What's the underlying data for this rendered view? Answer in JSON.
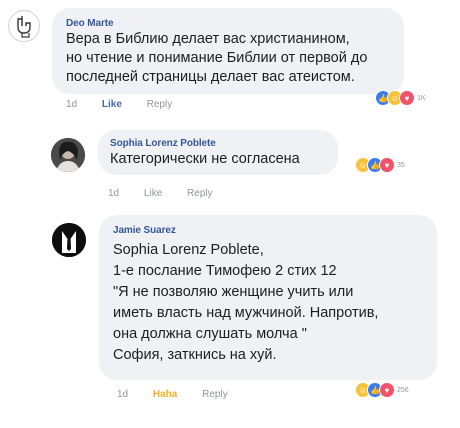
{
  "comments": [
    {
      "author": "Deo Marte",
      "lines": [
        "Вера в Библию делает вас христианином,",
        "но чтение и понимание Библии от первой до",
        "последней страницы делает вас атеистом."
      ],
      "time": "1d",
      "like_label": "Like",
      "reply_label": "Reply",
      "reaction_count": "1K",
      "reactions": [
        "like-reaction-icon",
        "haha-reaction-icon",
        "love-reaction-icon"
      ]
    },
    {
      "author": "Sophia Lorenz Poblete",
      "lines": [
        "Категорически не согласена"
      ],
      "time": "1d",
      "like_label": "Like",
      "reply_label": "Reply",
      "reaction_count": "35",
      "reactions": [
        "haha-reaction-icon",
        "like-reaction-icon",
        "love-reaction-icon"
      ]
    },
    {
      "author": "Jamie Suarez",
      "lines": [
        "Sophia Lorenz Poblete,",
        "1-е послание Тимофею 2 стих 12",
        "\"Я не позволяю женщине учить или",
        "иметь власть над мужчиной. Напротив,",
        "она должна слушать молча \"",
        "София, заткнись на хуй."
      ],
      "time": "1d",
      "like_label": "Haha",
      "reply_label": "Reply",
      "reaction_count": "256",
      "reactions": [
        "haha-reaction-icon",
        "like-reaction-icon",
        "love-reaction-icon"
      ]
    }
  ],
  "colors": {
    "bubble": "#eff1f4",
    "author": "#365899",
    "like": "#4267b2",
    "haha": "#f7b125",
    "meta": "#90949c"
  }
}
